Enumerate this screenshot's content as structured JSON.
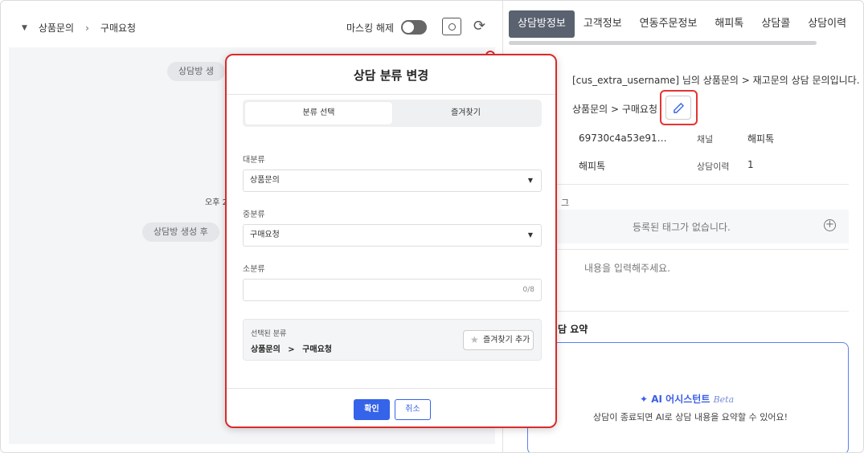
{
  "left": {
    "breadcrumb": {
      "category": "상품문의",
      "sub": "구매요청"
    },
    "masking_label": "마스킹 해제",
    "timeline": {
      "pill1": "상담방 생",
      "time": "오후 2",
      "pill2": "상담방 생성 후"
    }
  },
  "tabs": [
    "상담방정보",
    "고객정보",
    "연동주문정보",
    "해피톡",
    "상담콜",
    "상담이력",
    "I"
  ],
  "info": {
    "greeting": "[cus_extra_username] 님의 상품문의 > 재고문의 상담 문의입니다.",
    "category_path": "상품문의 > 구매요청",
    "room_id": "69730c4a53e91…",
    "channel_label": "채널",
    "channel_value": "해피톡",
    "agent": "해피톡",
    "history_label": "상담이력",
    "history_value": "1",
    "tag_label": "그",
    "tag_empty": "등록된 태그가 없습니다.",
    "memo_placeholder": "내용을 입력해주세요.",
    "summary_title": "담 요약"
  },
  "ai": {
    "title": "AI 어시스턴트",
    "beta": "Beta",
    "desc": "상담이 종료되면 AI로 상담 내용을 요약할 수 있어요!"
  },
  "modal": {
    "title": "상담 분류 변경",
    "tabs": {
      "select": "분류 선택",
      "favorites": "즐겨찾기"
    },
    "major": {
      "label": "대분류",
      "value": "상품문의"
    },
    "middle": {
      "label": "중분류",
      "value": "구매요청"
    },
    "minor": {
      "label": "소분류",
      "value": "",
      "count": "0/8"
    },
    "selected": {
      "label": "선택된 분류",
      "major": "상품문의",
      "sep": ">",
      "middle": "구매요청"
    },
    "add_favorite": "즐겨찾기 추가",
    "confirm": "확인",
    "cancel": "취소"
  },
  "colors": {
    "accent": "#3563e9",
    "highlight": "#d92b2b",
    "tab_active": "#5a6270"
  }
}
